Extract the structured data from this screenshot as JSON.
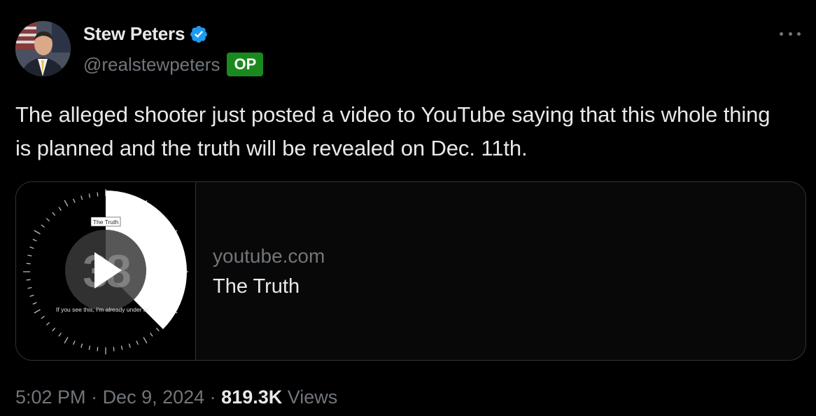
{
  "author": {
    "display_name": "Stew Peters",
    "handle": "@realstewpeters",
    "badge": "OP",
    "verified_icon": "verified-badge-icon",
    "badge_color": "#1a8a1e",
    "verified_color": "#1d9bf0"
  },
  "menu_icon": "more-icon",
  "tweet": {
    "text": "The alleged shooter just posted a video to YouTube saying that this whole thing is planned and the truth will be revealed on Dec. 11th."
  },
  "card": {
    "domain": "youtube.com",
    "title": "The Truth",
    "thumbnail": {
      "label": "The Truth",
      "number": "38",
      "caption": "If you see this, I'm already under ar",
      "play_icon": "play-icon"
    }
  },
  "meta": {
    "time": "5:02 PM",
    "separator": " · ",
    "date": "Dec 9, 2024",
    "separator2": " · ",
    "views_count": "819.3K",
    "views_label": " Views"
  }
}
